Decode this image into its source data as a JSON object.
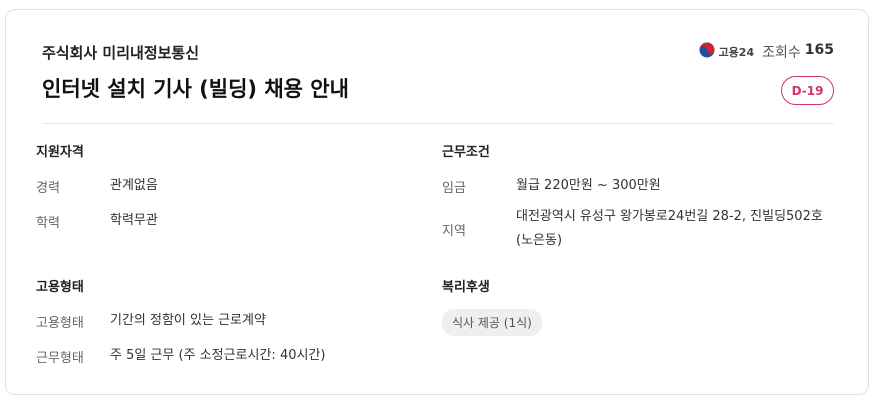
{
  "company": "주식회사 미리내정보통신",
  "title": "인터넷 설치 기사 (빌딩) 채용 안내",
  "source_logo_text": "고용24",
  "views": {
    "label": "조회수",
    "count": "165"
  },
  "dday": "D-19",
  "qualifications": {
    "heading": "지원자격",
    "rows": [
      {
        "label": "경력",
        "value": "관계없음"
      },
      {
        "label": "학력",
        "value": "학력무관"
      }
    ]
  },
  "conditions": {
    "heading": "근무조건",
    "rows": [
      {
        "label": "임금",
        "value": "월급 220만원 ~ 300만원"
      },
      {
        "label": "지역",
        "value": "대전광역시 유성구 왕가봉로24번길 28-2, 진빌딩502호 (노은동)"
      }
    ]
  },
  "employment": {
    "heading": "고용형태",
    "rows": [
      {
        "label": "고용형태",
        "value": "기간의 정함이 있는 근로계약"
      },
      {
        "label": "근무형태",
        "value": "주 5일 근무 (주 소정근로시간: 40시간)"
      }
    ]
  },
  "welfare": {
    "heading": "복리후생",
    "tags": [
      "식사 제공 (1식)"
    ]
  },
  "colors": {
    "accent": "#d6336c",
    "logo_red": "#d2232a",
    "logo_blue": "#1f4ea3"
  }
}
